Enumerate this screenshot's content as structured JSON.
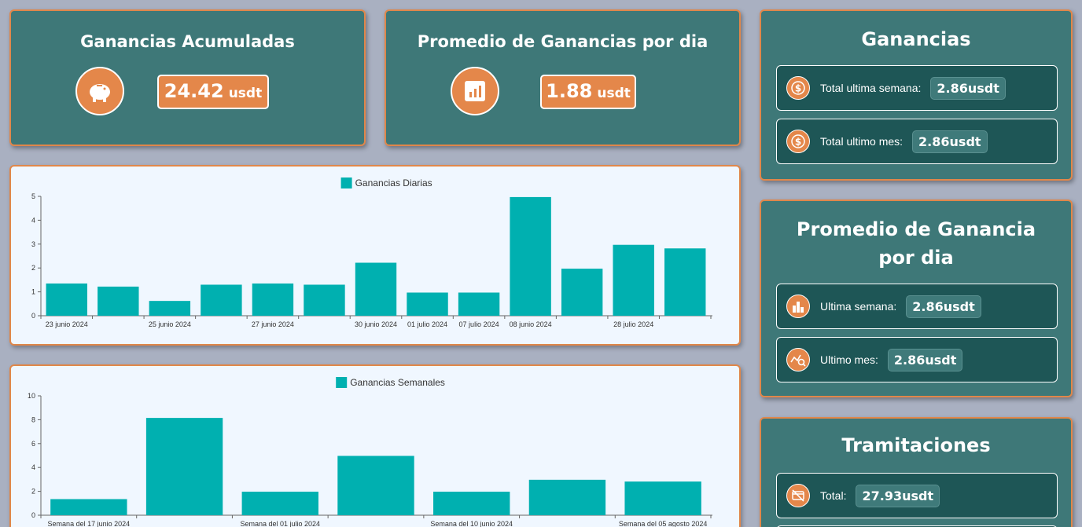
{
  "top_cards": {
    "accumulated": {
      "title": "Ganancias Acumuladas",
      "value": "24.42",
      "unit": "usdt",
      "icon": "piggy-bank-icon"
    },
    "daily_average": {
      "title": "Promedio de Ganancias por dia",
      "value": "1.88",
      "unit": "usdt",
      "icon": "bar-chart-icon"
    }
  },
  "ganancias": {
    "title": "Ganancias",
    "rows": [
      {
        "label": "Total ultima semana:",
        "value": "2.86",
        "unit": "usdt",
        "icon": "dollar-icon"
      },
      {
        "label": "Total ultimo mes:",
        "value": "2.86",
        "unit": "usdt",
        "icon": "dollar-icon"
      }
    ]
  },
  "promedio": {
    "title": "Promedio de Ganancia por dia",
    "rows": [
      {
        "label": "Ultima semana:",
        "value": "2.86",
        "unit": "usdt",
        "icon": "bar-chart-icon"
      },
      {
        "label": "Ultimo mes:",
        "value": "2.86",
        "unit": "usdt",
        "icon": "trend-search-icon"
      }
    ]
  },
  "tramitaciones": {
    "title": "Tramitaciones",
    "rows": [
      {
        "label": "Total:",
        "value": "27.93",
        "unit": "usdt",
        "icon": "no-card-icon"
      }
    ]
  },
  "colors": {
    "accent": "#e4874a",
    "card": "#3e7878",
    "bar": "#00b0b0"
  },
  "chart_data": [
    {
      "type": "bar",
      "legend": "Ganancias Diarias",
      "ylim": [
        0,
        5
      ],
      "yticks": [
        0,
        1,
        2,
        3,
        4,
        5
      ],
      "values": [
        1.35,
        1.22,
        0.62,
        1.3,
        1.35,
        1.3,
        2.22,
        0.97,
        0.97,
        4.97,
        1.97,
        2.97,
        2.82
      ],
      "categories": [
        "23 junio 2024",
        "",
        "25 junio 2024",
        "",
        "27 junio 2024",
        "",
        "30 junio 2024",
        "01 julio 2024",
        "07 julio 2024",
        "08 junio 2024",
        "",
        "28 julio 2024",
        ""
      ]
    },
    {
      "type": "bar",
      "legend": "Ganancias Semanales",
      "ylim": [
        0,
        10
      ],
      "yticks": [
        0,
        2,
        4,
        6,
        8,
        10
      ],
      "values": [
        1.35,
        8.15,
        1.97,
        4.97,
        1.97,
        2.97,
        2.82
      ],
      "categories": [
        "Semana del 17 junio 2024",
        "",
        "Semana del 01 julio 2024",
        "",
        "Semana del 10 junio 2024",
        "",
        "Semana del 05 agosto 2024"
      ]
    }
  ]
}
